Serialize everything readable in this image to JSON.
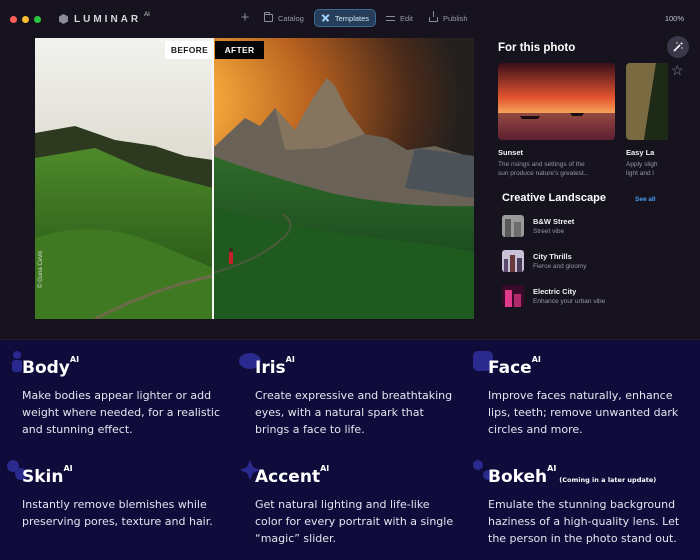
{
  "app": {
    "name": "LUMINAR",
    "name_suffix": "AI",
    "zoom": "100%"
  },
  "nav": {
    "items": [
      {
        "label": "Catalog",
        "icon": "folder-icon"
      },
      {
        "label": "Templates",
        "icon": "templates-icon",
        "active": true
      },
      {
        "label": "Edit",
        "icon": "edit-icon"
      },
      {
        "label": "Publish",
        "icon": "publish-icon"
      }
    ]
  },
  "photo": {
    "before_label": "BEFORE",
    "after_label": "AFTER",
    "credit": "© Guna Cevik",
    "comparison_split": 0.405
  },
  "panel": {
    "title": "For this photo",
    "cards": [
      {
        "name": "Sunset",
        "desc_line1": "The risings and settings of the",
        "desc_line2": "sun produce nature's greatest..."
      },
      {
        "name": "Easy La",
        "desc_line1": "Apply sligh",
        "desc_line2": "light and l"
      }
    ],
    "section_title": "Creative  Landscape",
    "see_all": "See all",
    "list": [
      {
        "name": "B&W Street",
        "sub": "Street vibe"
      },
      {
        "name": "City Thrills",
        "sub": "Fierce and gloomy"
      },
      {
        "name": "Electric City",
        "sub": "Enhance your urban vibe"
      }
    ]
  },
  "features": [
    {
      "title": "Body",
      "sup": "AI",
      "note": "",
      "desc": "Make bodies appear lighter or add weight where needed, for a realistic and stunning effect.",
      "icon": "body-icon"
    },
    {
      "title": "Iris",
      "sup": "AI",
      "note": "",
      "desc": "Create expressive and breathtaking eyes, with a natural spark that brings a face to life.",
      "icon": "iris-icon"
    },
    {
      "title": "Face",
      "sup": "AI",
      "note": "",
      "desc": "Improve faces naturally, enhance lips, teeth; remove unwanted dark circles and more.",
      "icon": "face-icon"
    },
    {
      "title": "Skin",
      "sup": "AI",
      "note": "",
      "desc": "Instantly remove blemishes while preserving pores, texture and hair.",
      "icon": "skin-icon"
    },
    {
      "title": "Accent",
      "sup": "AI",
      "note": "",
      "desc": "Get natural lighting and life-like color for every portrait with a single “magic” slider.",
      "icon": "accent-icon"
    },
    {
      "title": "Bokeh",
      "sup": "AI",
      "note": "(Coming in a later update)",
      "desc": "Emulate the stunning background haziness of a high-quality lens. Let the person in the photo stand out.",
      "icon": "bokeh-icon"
    }
  ],
  "colors": {
    "page_background": "#0f0b3a",
    "window_background": "#16131f",
    "accent_blue": "#4a9df2",
    "active_tab": "#263e5a",
    "traffic_red": "#ff5f57",
    "traffic_yellow": "#febc2e",
    "traffic_green": "#28c840"
  }
}
